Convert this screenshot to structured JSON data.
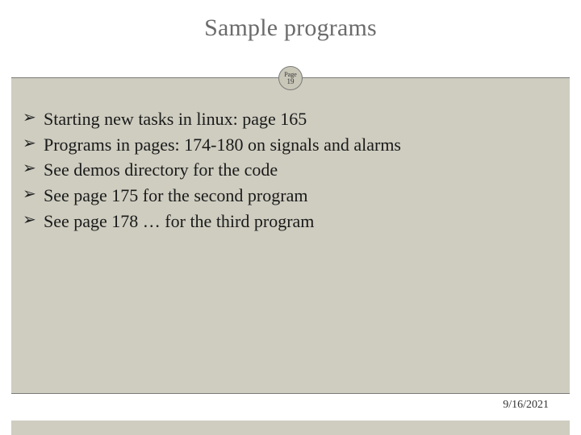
{
  "title": "Sample programs",
  "page": {
    "label": "Page",
    "number": "19"
  },
  "bullets": [
    "Starting new tasks in linux: page 165",
    "Programs in pages: 174-180 on signals and alarms",
    "See demos directory for the code",
    "See page 175 for the second program",
    "See page 178 … for the third program"
  ],
  "footer": {
    "date": "9/16/2021"
  }
}
